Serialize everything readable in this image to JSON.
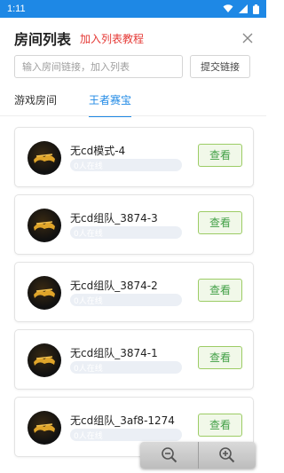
{
  "status_bar": {
    "time": "1:11",
    "icons": [
      "wifi-icon",
      "signal-icon",
      "battery-icon"
    ]
  },
  "header": {
    "title": "房间列表",
    "tutorial_link": "加入列表教程",
    "close_icon": "close-icon"
  },
  "search": {
    "placeholder": "输入房间链接，加入列表",
    "value": "",
    "submit_label": "提交链接"
  },
  "tabs": [
    {
      "label": "游戏房间",
      "active": false
    },
    {
      "label": "王者赛宝",
      "active": true
    }
  ],
  "rooms": [
    {
      "name": "无cd模式-4",
      "online": "0人在线",
      "action": "查看"
    },
    {
      "name": "无cd组队_3874-3",
      "online": "0人在线",
      "action": "查看"
    },
    {
      "name": "无cd组队_3874-2",
      "online": "0人在线",
      "action": "查看"
    },
    {
      "name": "无cd组队_3874-1",
      "online": "0人在线",
      "action": "查看"
    },
    {
      "name": "无cd组队_3af8-1274",
      "online": "0人在线",
      "action": "查看"
    }
  ],
  "colors": {
    "accent": "#1e88e5",
    "link_red": "#e53935",
    "view_green": "#43a047"
  },
  "zoom": {
    "icons": [
      "zoom-out-icon",
      "zoom-in-icon"
    ]
  }
}
